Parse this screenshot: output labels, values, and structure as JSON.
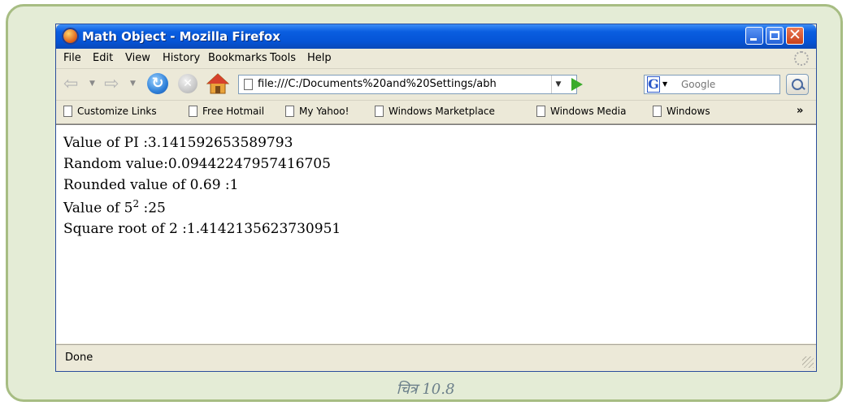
{
  "window": {
    "title": "Math Object - Mozilla Firefox"
  },
  "menu": [
    "File",
    "Edit",
    "View",
    "History",
    "Bookmarks",
    "Tools",
    "Help"
  ],
  "address_bar": {
    "url": "file:///C:/Documents%20and%20Settings/abh"
  },
  "search": {
    "placeholder": "Google"
  },
  "bookmarks": [
    "Customize Links",
    "Free Hotmail",
    "My Yahoo!",
    "Windows Marketplace",
    "Windows Media",
    "Windows"
  ],
  "bookmarks_overflow": "»",
  "content": {
    "pi_label": "Value of PI :",
    "pi_value": "3.141592653589793",
    "random_label": "Random value:",
    "random_value": "0.09442247957416705",
    "rounded_label": "Rounded value of 0.69 :",
    "rounded_value": "1",
    "power_label": "Value of 5",
    "power_exponent": "2",
    "power_value": " :25",
    "sqrt_label": "Square root of 2 :",
    "sqrt_value": "1.4142135623730951"
  },
  "status": "Done",
  "caption": "चित्र 10.8"
}
